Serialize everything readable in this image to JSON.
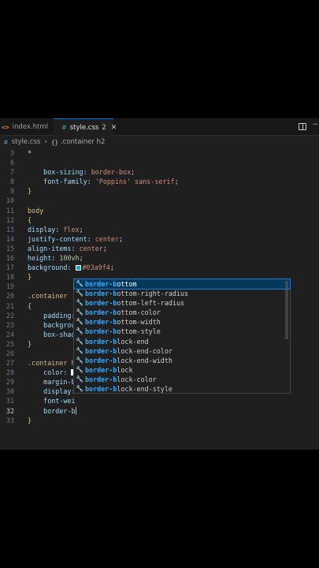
{
  "tabs": [
    {
      "name": "index.html",
      "icon": "html-file-icon"
    },
    {
      "name": "style.css",
      "icon": "css-file-icon",
      "problems": "2",
      "active": true
    }
  ],
  "breadcrumb": {
    "file": "style.css",
    "symbol": "{}",
    "item": ".container h2"
  },
  "code": {
    "line_numbers": [
      "3",
      "6",
      "7",
      "8",
      "9",
      "10",
      "11",
      "12",
      "13",
      "14",
      "15",
      "16",
      "17",
      "18",
      "19",
      "20",
      "21",
      "22",
      "23",
      "24",
      "25",
      "26",
      "27",
      "28",
      "29",
      "30",
      "31",
      "32",
      "33"
    ],
    "l3": "*",
    "l7_prop": "box-sizing",
    "l7_val": "border-box",
    "l8_prop": "font-family",
    "l8_val": "'Poppins'",
    "l8_val2": "sans-serif",
    "l9": "}",
    "l11": "body",
    "l12": "{",
    "l13_prop": "display",
    "l13_val": "flex",
    "l14_prop": "justify-content",
    "l14_val": "center",
    "l15_prop": "align-items",
    "l15_val": "center",
    "l16_prop": "height",
    "l16_val": "100vh",
    "l17_prop": "background",
    "l17_val": "#03a9f4",
    "l18": "}",
    "l20": ".container",
    "l21": "{",
    "l22": "padding:",
    "l23": "backgrou",
    "l24": "box-shad",
    "l25": "}",
    "l27": ".container h",
    "l28": "color:",
    "l29": "margin-b",
    "l30": "display:",
    "l31": "font-wei",
    "l32": "border-b",
    "swatch_color": "#03a9f4"
  },
  "suggestions": [
    {
      "match": "border-b",
      "rest": "ottom"
    },
    {
      "match": "border-b",
      "rest": "ottom-right-radius"
    },
    {
      "match": "border-b",
      "rest": "ottom-left-radius"
    },
    {
      "match": "border-b",
      "rest": "ottom-color"
    },
    {
      "match": "border-b",
      "rest": "ottom-width"
    },
    {
      "match": "border-b",
      "rest": "ottom-style"
    },
    {
      "match": "border-b",
      "rest": "lock-end"
    },
    {
      "match": "border-b",
      "rest": "lock-end-color"
    },
    {
      "match": "border-b",
      "rest": "lock-end-width"
    },
    {
      "match": "border-b",
      "rest": "lock"
    },
    {
      "match": "border-b",
      "rest": "lock-color"
    },
    {
      "match": "border-b",
      "rest": "lock-end-style"
    }
  ]
}
